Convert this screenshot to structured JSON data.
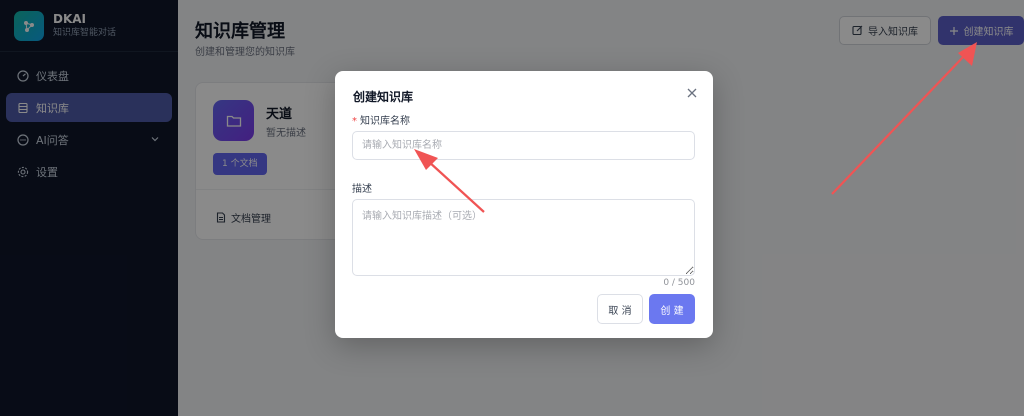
{
  "brand": {
    "name": "DKAI",
    "subtitle": "知识库智能对话"
  },
  "sidebar": {
    "items": [
      {
        "label": "仪表盘",
        "icon": "dashboard-icon",
        "active": false
      },
      {
        "label": "知识库",
        "icon": "database-icon",
        "active": true
      },
      {
        "label": "AI问答",
        "icon": "chat-icon",
        "active": false,
        "expandable": true
      },
      {
        "label": "设置",
        "icon": "gear-icon",
        "active": false
      }
    ]
  },
  "header": {
    "title": "知识库管理",
    "subtitle": "创建和管理您的知识库",
    "import_label": "导入知识库",
    "create_label": "创建知识库"
  },
  "kb_card": {
    "name": "天道",
    "description": "暂无描述",
    "doc_count": "1 个文档",
    "doc_manage": "文档管理"
  },
  "dialog": {
    "title": "创建知识库",
    "name_label": "知识库名称",
    "name_placeholder": "请输入知识库名称",
    "desc_label": "描述",
    "desc_placeholder": "请输入知识库描述（可选）",
    "counter": "0 / 500",
    "cancel_label": "取 消",
    "create_label": "创 建"
  },
  "colors": {
    "sidebar_bg": "#0f172a",
    "accent": "#5b5fc7",
    "primary_button": "#6b78f0",
    "annotation_arrow": "#f05454"
  }
}
